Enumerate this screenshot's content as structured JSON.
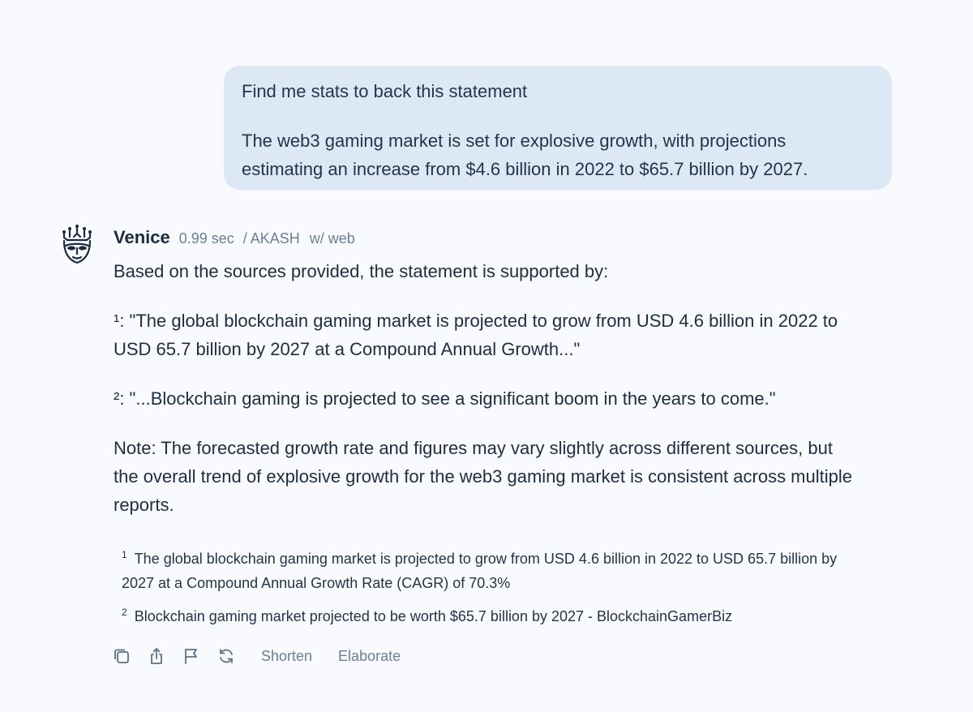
{
  "user_message": {
    "line1": "Find me stats to back this statement",
    "line2": "The web3 gaming market is set for explosive growth, with projections",
    "line3": "estimating an increase from $4.6 billion in 2022 to $65.7 billion by 2027."
  },
  "assistant": {
    "avatar_icon": "venice-mask-icon",
    "name": "Venice",
    "time": "0.99 sec",
    "model": "/ AKASH",
    "mode": "w/ web",
    "intro": "Based on the sources provided, the statement is supported by:",
    "quote1": "¹: \"The global blockchain gaming market is projected to grow from USD 4.6 billion in 2022 to USD 65.7 billion by 2027 at a Compound Annual Growth...\"",
    "quote2": "²: \"...Blockchain gaming is projected to see a significant boom in the years to come.\"",
    "note": "Note: The forecasted growth rate and figures may vary slightly across different sources, but the overall trend of explosive growth for the web3 gaming market is consistent across multiple reports."
  },
  "references": [
    {
      "number": "1",
      "text": "The global blockchain gaming market is projected to grow from USD 4.6 billion in 2022 to USD 65.7 billion by 2027 at a Compound Annual Growth Rate (CAGR) of 70.3%"
    },
    {
      "number": "2",
      "text": "Blockchain gaming market projected to be worth $65.7 billion by 2027 - BlockchainGamerBiz"
    }
  ],
  "actions": {
    "icons": [
      "copy-icon",
      "share-icon",
      "flag-icon",
      "regenerate-icon"
    ],
    "shorten": "Shorten",
    "elaborate": "Elaborate"
  },
  "colors": {
    "background": "#f8fafd",
    "user_bubble": "#dce9f4",
    "text": "#1e2d42",
    "muted": "#6a7f97"
  }
}
